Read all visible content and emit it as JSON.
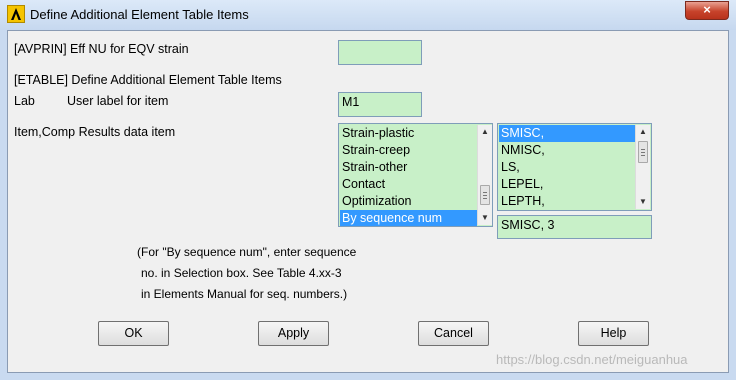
{
  "window": {
    "title": "Define Additional Element Table Items",
    "close_glyph": "×"
  },
  "avprin": {
    "label": "[AVPRIN]  Eff NU for EQV strain",
    "value": ""
  },
  "etable": {
    "label": "[ETABLE]  Define Additional Element Table Items"
  },
  "lab": {
    "label_key": "Lab",
    "label_desc": "User label for item",
    "value": "M1"
  },
  "item": {
    "label": "Item,Comp  Results data item",
    "left_list": [
      {
        "label": "Strain-plastic",
        "selected": false
      },
      {
        "label": "Strain-creep",
        "selected": false
      },
      {
        "label": "Strain-other",
        "selected": false
      },
      {
        "label": "Contact",
        "selected": false
      },
      {
        "label": "Optimization",
        "selected": false
      },
      {
        "label": "By sequence num",
        "selected": true
      }
    ],
    "right_list": [
      {
        "label": "SMISC,",
        "selected": true
      },
      {
        "label": "NMISC,",
        "selected": false
      },
      {
        "label": "LS,",
        "selected": false
      },
      {
        "label": "LEPEL,",
        "selected": false
      },
      {
        "label": "LEPTH,",
        "selected": false
      }
    ],
    "selection_value": "SMISC, 3"
  },
  "note": {
    "line1": "(For \"By sequence num\", enter sequence",
    "line2": "no. in Selection box.  See Table 4.xx-3",
    "line3": "in Elements Manual for seq. numbers.)"
  },
  "buttons": {
    "ok": "OK",
    "apply": "Apply",
    "cancel": "Cancel",
    "help": "Help"
  },
  "watermark": "https://blog.csdn.net/meiguanhua",
  "colors": {
    "field_bg": "#c8f0c8",
    "selection": "#3399ff",
    "dialog_bg": "#f0f0f0"
  },
  "icons": {
    "app": "ansys-logo-icon",
    "close": "close-icon"
  }
}
